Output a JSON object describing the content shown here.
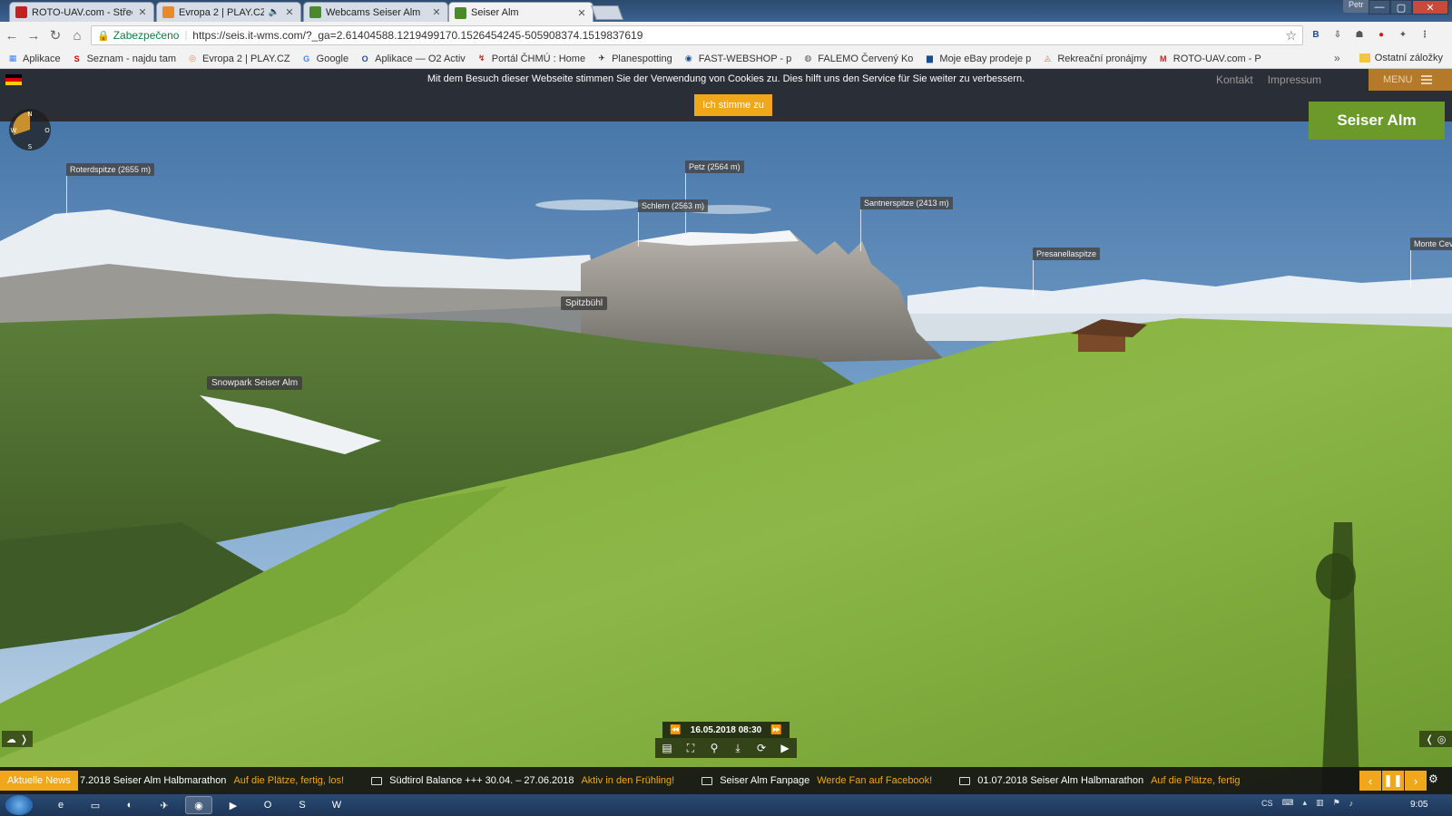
{
  "browser": {
    "tabs": [
      {
        "title": "ROTO-UAV.com - Středa",
        "favicon": "gmail-icon",
        "color": "#c5221f",
        "active": false,
        "muted": false
      },
      {
        "title": "Evropa 2 | PLAY.CZ",
        "favicon": "play-cz-icon",
        "color": "#e8892b",
        "active": false,
        "muted": true
      },
      {
        "title": "Webcams Seiser Alm",
        "favicon": "seiser-alm-icon",
        "color": "#4b8a2a",
        "active": false,
        "muted": false
      },
      {
        "title": "Seiser Alm",
        "favicon": "seiser-alm-icon",
        "color": "#4b8a2a",
        "active": true,
        "muted": false
      }
    ],
    "profile_name": "Petr",
    "omnibox": {
      "secure_label": "Zabezpečeno",
      "url": "https://seis.it-wms.com/?_ga=2.61404588.1219499170.1526454245-505908374.1519837619"
    },
    "bookmarks": [
      {
        "label": "Aplikace",
        "icon": "apps-grid-icon",
        "color": "#4285f4"
      },
      {
        "label": "Seznam - najdu tam",
        "icon": "seznam-icon",
        "color": "#cc0000"
      },
      {
        "label": "Evropa 2 | PLAY.CZ",
        "icon": "play-cz-icon",
        "color": "#e8892b"
      },
      {
        "label": "Google",
        "icon": "google-icon",
        "color": "#4285f4"
      },
      {
        "label": "Aplikace — O2 Activ",
        "icon": "o2-icon",
        "color": "#1a4d8f"
      },
      {
        "label": "Portál ČHMÚ : Home",
        "icon": "chmu-icon",
        "color": "#c5221f"
      },
      {
        "label": "Planespotting",
        "icon": "plane-icon",
        "color": "#222222"
      },
      {
        "label": "FAST-WEBSHOP - p",
        "icon": "fast-icon",
        "color": "#1a4d8f"
      },
      {
        "label": "FALEMO Červený Ko",
        "icon": "falemo-icon",
        "color": "#555555"
      },
      {
        "label": "Moje eBay prodeje p",
        "icon": "ebay-icon",
        "color": "#1a4d8f"
      },
      {
        "label": "Rekreační pronájmy",
        "icon": "airbnb-icon",
        "color": "#ff5a5f"
      },
      {
        "label": "ROTO-UAV.com - P",
        "icon": "gmail-icon",
        "color": "#c5221f"
      }
    ],
    "other_bookmarks": "Ostatní záložky"
  },
  "site": {
    "cookie": {
      "text": "Mit dem Besuch dieser Webseite stimmen Sie der Verwendung von Cookies zu. Dies hilft uns den Service für Sie weiter zu verbessern.",
      "accept_label": "Ich stimme zu"
    },
    "nav": {
      "contact": "Kontakt",
      "imprint": "Impressum",
      "menu": "MENU"
    },
    "logo_text": "Seiser Alm",
    "accent": "#f0a71a",
    "brand_green": "#6b9a2a"
  },
  "panorama": {
    "peaks": [
      {
        "label": "Roterdspitze (2655 m)"
      },
      {
        "label": "Petz (2564 m)"
      },
      {
        "label": "Schlern (2563 m)"
      },
      {
        "label": "Santnerspitze (2413 m)"
      },
      {
        "label": "Presanellaspitze"
      },
      {
        "label": "Monte Cev"
      }
    ],
    "pois": [
      {
        "label": "Spitzbühl"
      },
      {
        "label": "Snowpark Seiser Alm"
      }
    ],
    "compass": {
      "north": "N",
      "east": "O",
      "south": "S",
      "west": "W"
    }
  },
  "player": {
    "timestamp": "16.05.2018 08:30"
  },
  "news": {
    "label": "Aktuelle News",
    "items": [
      {
        "title": "7.2018 Seiser Alm Halbmarathon",
        "link": "Auf die Plätze, fertig, los!",
        "icon": false
      },
      {
        "title": "Südtirol Balance +++ 30.04. – 27.06.2018",
        "link": "Aktiv in den Frühling!",
        "icon": true
      },
      {
        "title": "Seiser Alm Fanpage",
        "link": "Werde Fan auf Facebook!",
        "icon": true
      },
      {
        "title": "01.07.2018 Seiser Alm Halbmarathon",
        "link": "Auf die Plätze, fertig",
        "icon": true
      }
    ]
  },
  "taskbar": {
    "tray_lang": "CS",
    "clock": "9:05"
  }
}
